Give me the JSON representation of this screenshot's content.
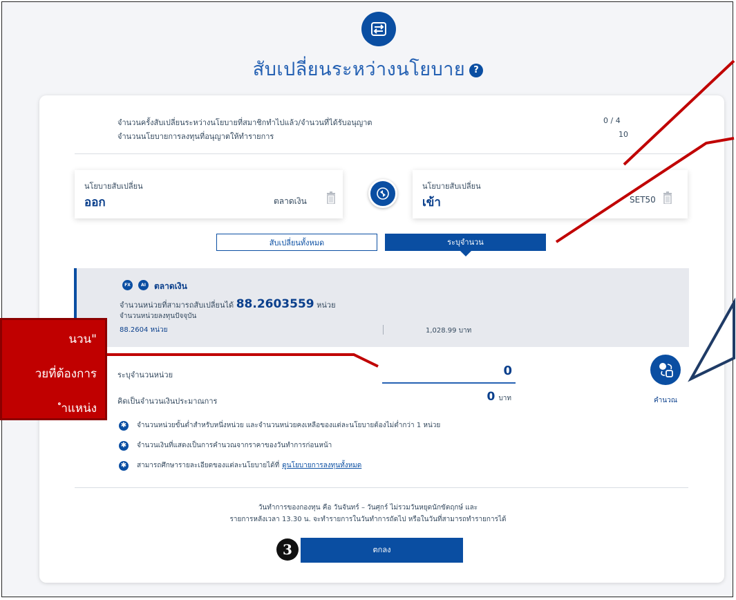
{
  "title": "สับเปลี่ยนระหว่างนโยบาย",
  "help_icon": "?",
  "info": {
    "line1_label": "จำนวนครั้งสับเปลี่ยนระหว่างนโยบายที่สมาชิกทำไปแล้ว/จำนวนที่ได้รับอนุญาต",
    "line1_value": "0 / 4",
    "line2_label": "จำนวนนโยบายการลงทุนที่อนุญาตให้ทำรายการ",
    "line2_value": "10"
  },
  "switch_out": {
    "label": "นโยบายสับเปลี่ยน",
    "direction": "ออก",
    "fund": "ตลาดเงิน"
  },
  "switch_in": {
    "label": "นโยบายสับเปลี่ยน",
    "direction": "เข้า",
    "fund": "SET50"
  },
  "tabs": {
    "all": "สับเปลี่ยนทั้งหมด",
    "specify": "ระบุจำนวน"
  },
  "fund_panel": {
    "badge1": "FX",
    "badge2": "AI",
    "name": "ตลาดเงิน",
    "switchable_label": "จำนวนหน่วยที่สามารถสับเปลี่ยนได้",
    "switchable_value": "88.2603559",
    "switchable_unit": "หน่วย",
    "current_label": "จำนวนหน่วยลงทุนปัจจุบัน",
    "current_units": "88.2604 หน่วย",
    "current_amount": "1,028.99 บาท"
  },
  "form": {
    "units_label": "ระบุจำนวนหน่วย",
    "units_value": "0",
    "amount_label": "คิดเป็นจำนวนเงินประมาณการ",
    "amount_value": "0",
    "amount_unit": "บาท",
    "calc_label": "คำนวณ"
  },
  "notes": [
    "จำนวนหน่วยขั้นต่ำสำหรับหนึ่งหน่วย และจำนวนหน่วยคงเหลือของแต่ละนโยบายต้องไม่ต่ำกว่า 1 หน่วย",
    "จำนวนเงินที่แสดงเป็นการคำนวณจากราคาของวันทำการก่อนหน้า",
    "สามารถศึกษารายละเอียดของแต่ละนโยบายได้ที่"
  ],
  "notes_link": "ดูนโยบายการลงทุนทั้งหมด",
  "footer": {
    "line1": "วันทำการของกองทุน คือ วันจันทร์ – วันศุกร์ ไม่รวมวันหยุดนักขัตฤกษ์ และ",
    "line2": "รายการหลังเวลา 13.30 น. จะทำรายการในวันทำการถัดไป หรือในวันที่สามารถทำรายการได้"
  },
  "ok_button": "ตกลง",
  "step_number": "3",
  "annotation": {
    "line1": "นวน\"",
    "line2": "วยที่ต้องการ",
    "line3": "ำแหน่ง"
  },
  "colors": {
    "primary": "#0a4ea2",
    "annotation_red": "#c00000",
    "arrow_red": "#c00000",
    "callout_blue": "#1f3b66"
  }
}
